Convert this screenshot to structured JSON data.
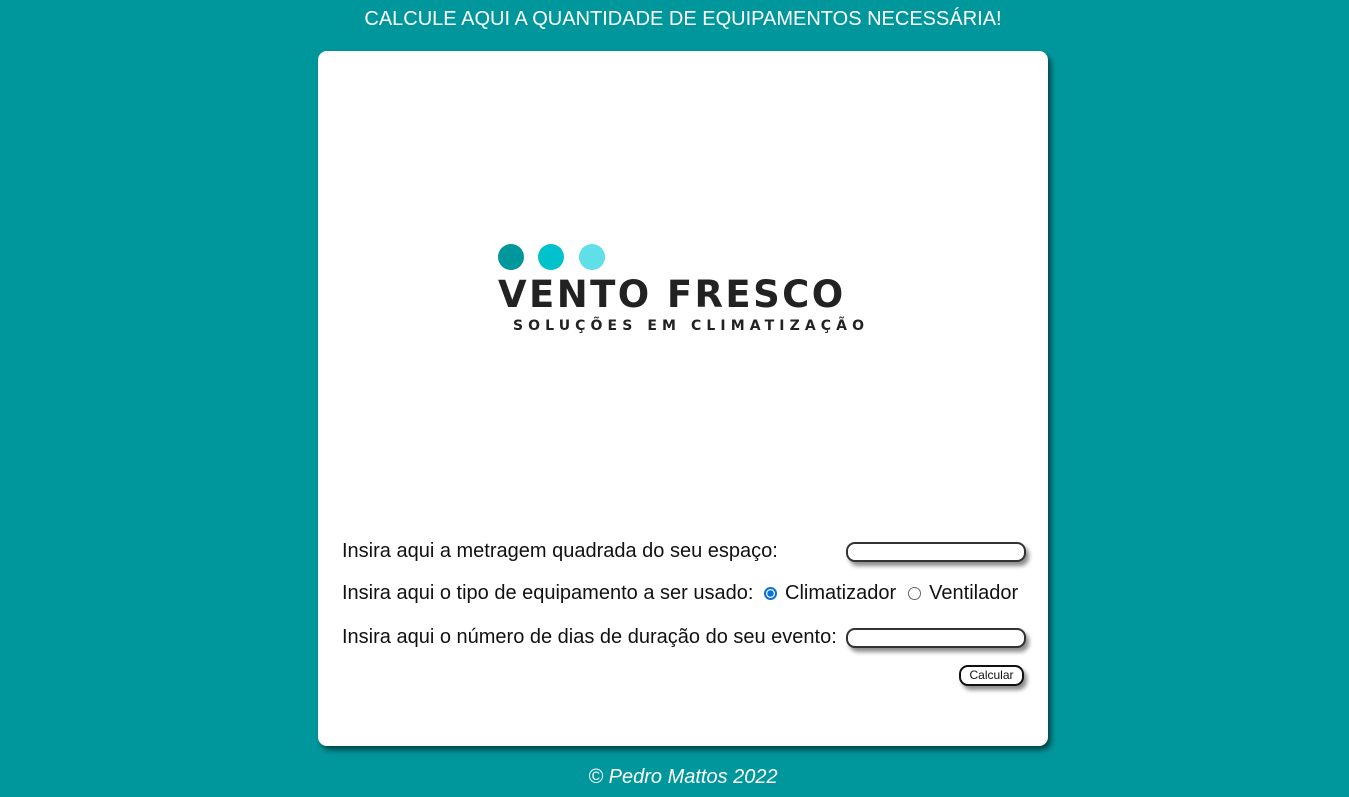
{
  "header": {
    "title": "CALCULE AQUI A QUANTIDADE DE EQUIPAMENTOS NECESSÁRIA!"
  },
  "logo": {
    "brand": "VENTO FRESCO",
    "tagline": "SOLUÇÕES EM CLIMATIZAÇÃO",
    "dot_colors": [
      "#00979c",
      "#00c2cc",
      "#5fe0e8"
    ]
  },
  "form": {
    "area_label": "Insira aqui a metragem quadrada do seu espaço:",
    "area_value": "",
    "equipment_label": "Insira aqui o tipo de equipamento a ser usado:",
    "equipment_options": [
      {
        "label": "Climatizador",
        "checked": true
      },
      {
        "label": "Ventilador",
        "checked": false
      }
    ],
    "days_label": "Insira aqui o número de dias de duração do seu evento:",
    "days_value": "",
    "submit_label": "Calcular"
  },
  "footer": {
    "text": "© Pedro Mattos 2022"
  },
  "colors": {
    "background": "#00979c",
    "card": "#ffffff",
    "radio_accent": "#0a6fd6"
  }
}
